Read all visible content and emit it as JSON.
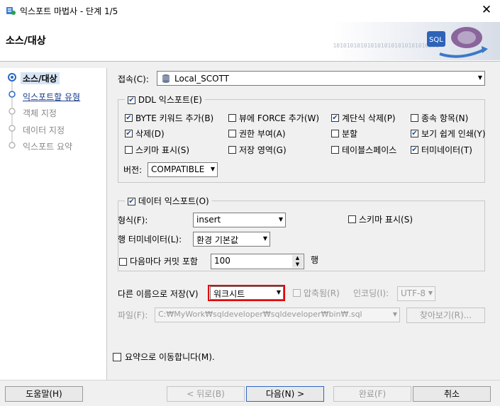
{
  "window": {
    "title": "익스포트 마법사 - 단계 1/5",
    "close": "✕"
  },
  "banner": {
    "title": "소스/대상",
    "art_text": "SQL",
    "binary": "0101010101010101010101010101010101"
  },
  "steps": [
    {
      "label": "소스/대상",
      "state": "current"
    },
    {
      "label": "익스포트할 유형",
      "state": "link"
    },
    {
      "label": "객체 지정",
      "state": "disabled"
    },
    {
      "label": "데이터 지정",
      "state": "disabled"
    },
    {
      "label": "익스포트 요약",
      "state": "disabled"
    }
  ],
  "connection": {
    "label": "접속(C):",
    "value": "Local_SCOTT"
  },
  "ddl": {
    "label": "DDL 익스포트(E)",
    "checked": true,
    "options": [
      {
        "label": "BYTE 키워드 추가(B)",
        "checked": true
      },
      {
        "label": "뷰에 FORCE 추가(W)",
        "checked": false
      },
      {
        "label": "계단식 삭제(P)",
        "checked": true
      },
      {
        "label": "종속 항목(N)",
        "checked": false
      },
      {
        "label": "삭제(D)",
        "checked": true
      },
      {
        "label": "권한 부여(A)",
        "checked": false
      },
      {
        "label": "분할",
        "checked": false
      },
      {
        "label": "보기 쉽게 인쇄(Y)",
        "checked": true
      },
      {
        "label": "스키마 표시(S)",
        "checked": false
      },
      {
        "label": "저장 영역(G)",
        "checked": false
      },
      {
        "label": "테이블스페이스",
        "checked": false
      },
      {
        "label": "터미네이터(T)",
        "checked": true
      }
    ],
    "version_label": "버전:",
    "version_value": "COMPATIBLE"
  },
  "data_export": {
    "label": "데이터 익스포트(O)",
    "checked": true,
    "format_label": "형식(F):",
    "format_value": "insert",
    "schema_label": "스키마 표시(S)",
    "schema_checked": false,
    "terminator_label": "행 터미네이터(L):",
    "terminator_value": "환경 기본값",
    "commit_label": "다음마다 커밋 포함",
    "commit_checked": false,
    "commit_value": "100",
    "rows_label": "행"
  },
  "save": {
    "label": "다른 이름으로 저장(V)",
    "value": "워크시트",
    "compressed_label": "압축됨(R)",
    "encoding_label": "인코딩(I):",
    "encoding_value": "UTF-8",
    "file_label": "파일(F):",
    "file_value": "C:₩MyWork₩sqldeveloper₩sqldeveloper₩bin₩.sql",
    "browse_label": "찾아보기(R)...",
    "highlight_color": "#e00000"
  },
  "summary": {
    "label": "요약으로 이동합니다(M).",
    "checked": false
  },
  "footer": {
    "help": "도움말(H)",
    "back": "< 뒤로(B)",
    "next": "다음(N) >",
    "finish": "완료(F)",
    "cancel": "취소"
  }
}
